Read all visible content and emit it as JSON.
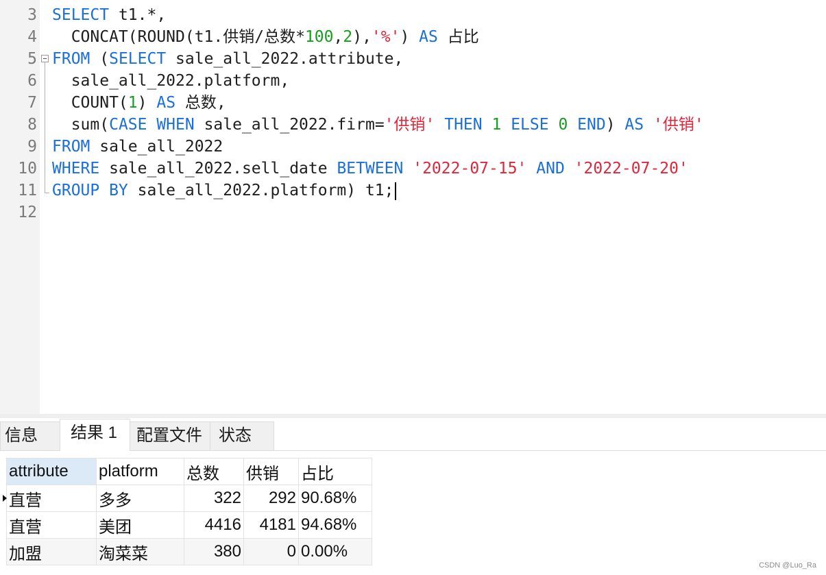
{
  "editor": {
    "line_numbers": [
      "3",
      "4",
      "5",
      "6",
      "7",
      "8",
      "9",
      "10",
      "11",
      "12"
    ],
    "lines": [
      [
        [
          "k",
          "SELECT"
        ],
        [
          "t",
          " t1.*,"
        ]
      ],
      [
        [
          "t",
          "  CONCAT(ROUND(t1.供销/总数*"
        ],
        [
          "n",
          "100"
        ],
        [
          "t",
          ","
        ],
        [
          "n",
          "2"
        ],
        [
          "t",
          "),"
        ],
        [
          "s",
          "'%'"
        ],
        [
          "t",
          ") "
        ],
        [
          "k",
          "AS"
        ],
        [
          "t",
          " 占比"
        ]
      ],
      [
        [
          "k",
          "FROM"
        ],
        [
          "t",
          " ("
        ],
        [
          "k",
          "SELECT"
        ],
        [
          "t",
          " sale_all_2022.attribute,"
        ]
      ],
      [
        [
          "t",
          "  sale_all_2022.platform,"
        ]
      ],
      [
        [
          "t",
          "  COUNT("
        ],
        [
          "n",
          "1"
        ],
        [
          "t",
          ") "
        ],
        [
          "k",
          "AS"
        ],
        [
          "t",
          " 总数,"
        ]
      ],
      [
        [
          "t",
          "  sum("
        ],
        [
          "k",
          "CASE WHEN"
        ],
        [
          "t",
          " sale_all_2022.firm="
        ],
        [
          "s",
          "'供销'"
        ],
        [
          "t",
          " "
        ],
        [
          "k",
          "THEN"
        ],
        [
          "t",
          " "
        ],
        [
          "n",
          "1"
        ],
        [
          "t",
          " "
        ],
        [
          "k",
          "ELSE"
        ],
        [
          "t",
          " "
        ],
        [
          "n",
          "0"
        ],
        [
          "t",
          " "
        ],
        [
          "k",
          "END"
        ],
        [
          "t",
          ") "
        ],
        [
          "k",
          "AS"
        ],
        [
          "t",
          " "
        ],
        [
          "s",
          "'供销'"
        ]
      ],
      [
        [
          "k",
          "FROM"
        ],
        [
          "t",
          " sale_all_2022"
        ]
      ],
      [
        [
          "k",
          "WHERE"
        ],
        [
          "t",
          " sale_all_2022.sell_date "
        ],
        [
          "k",
          "BETWEEN"
        ],
        [
          "t",
          " "
        ],
        [
          "s",
          "'2022-07-15'"
        ],
        [
          "t",
          " "
        ],
        [
          "k",
          "AND"
        ],
        [
          "t",
          " "
        ],
        [
          "s",
          "'2022-07-20'"
        ]
      ],
      [
        [
          "k",
          "GROUP BY"
        ],
        [
          "t",
          " sale_all_2022.platform) t1;"
        ]
      ],
      []
    ]
  },
  "tabs": [
    "信息",
    "结果 1",
    "配置文件",
    "状态"
  ],
  "active_tab": 1,
  "result": {
    "columns": [
      "attribute",
      "platform",
      "总数",
      "供销",
      "占比"
    ],
    "rows": [
      [
        "直营",
        "多多",
        "322",
        "292",
        "90.68%"
      ],
      [
        "直营",
        "美团",
        "4416",
        "4181",
        "94.68%"
      ],
      [
        "加盟",
        "淘菜菜",
        "380",
        "0",
        "0.00%"
      ]
    ]
  },
  "watermark": "CSDN @Luo_Ra",
  "colors": {
    "keyword": "#1a6fe0",
    "number": "#14a01e",
    "string": "#e0253a",
    "selected_header": "#dceaf7"
  }
}
